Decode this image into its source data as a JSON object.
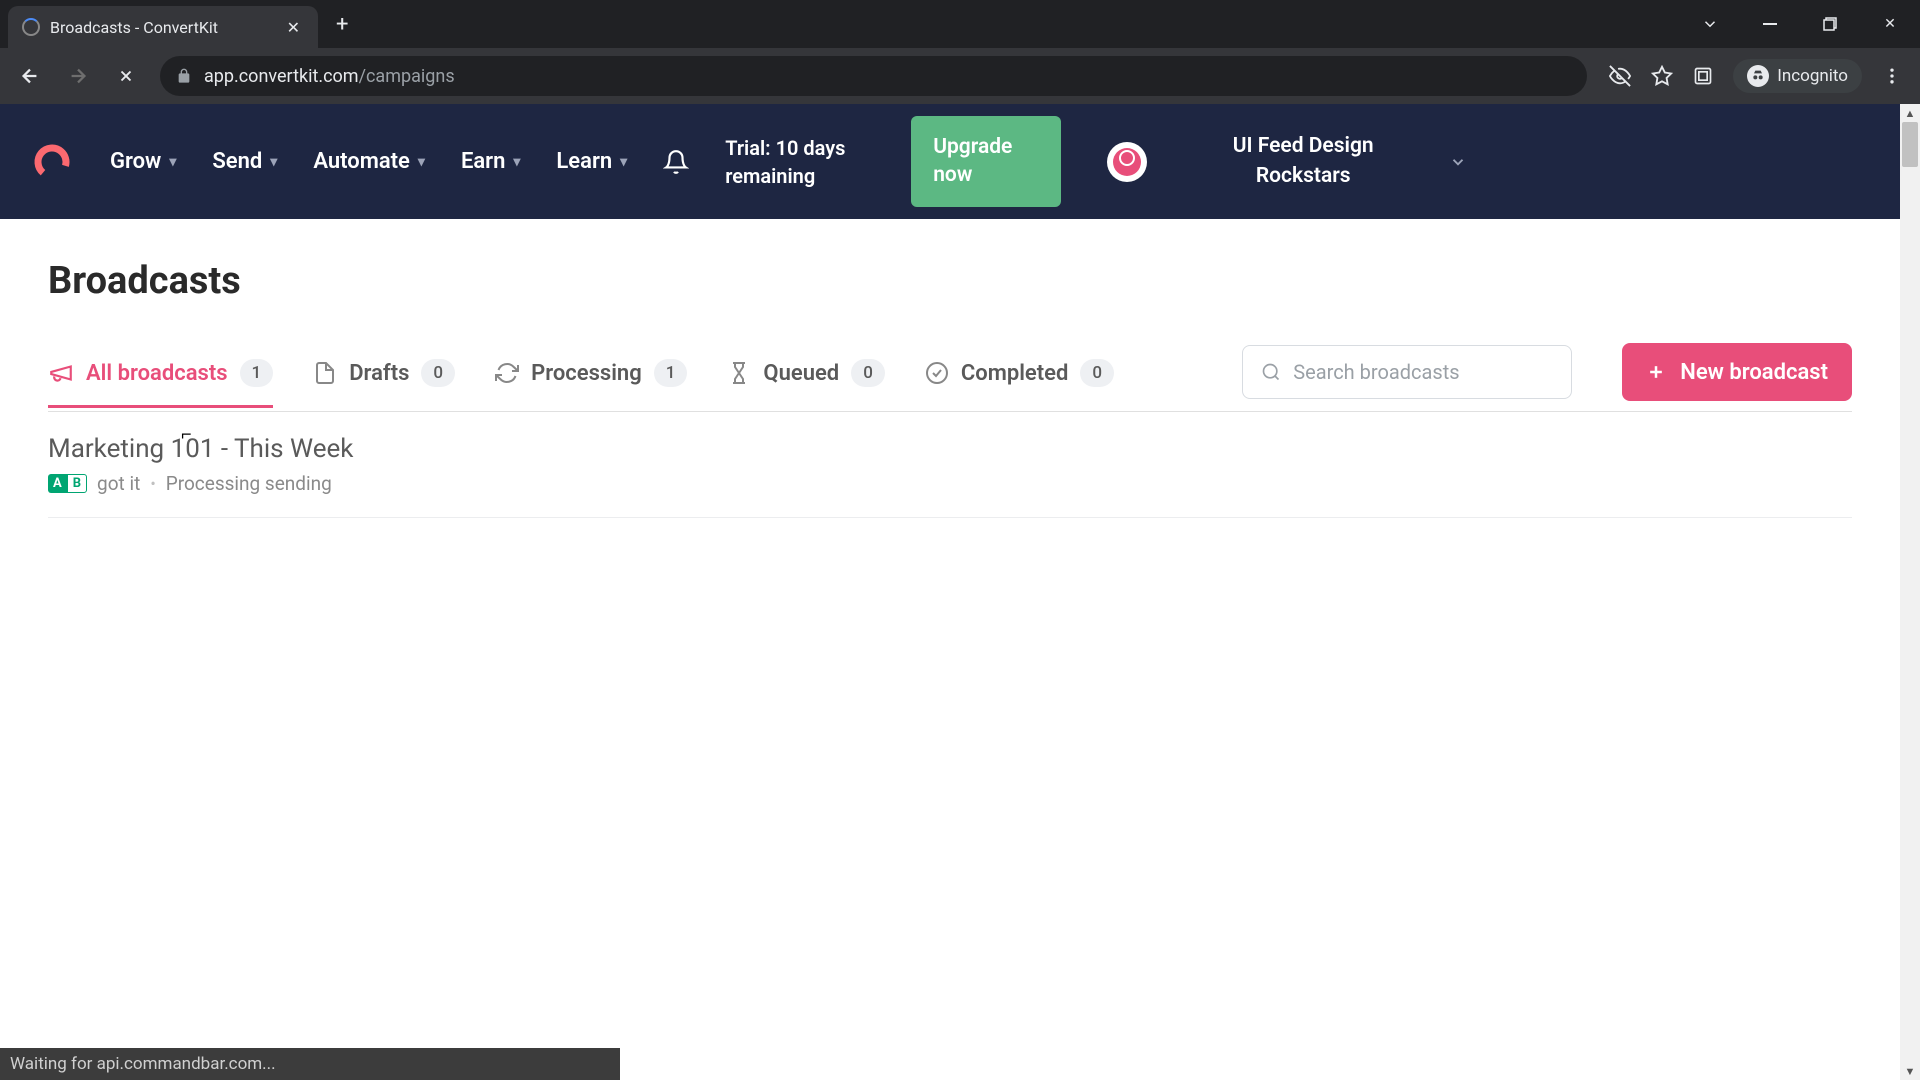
{
  "browser": {
    "tab_title": "Broadcasts - ConvertKit",
    "url_host": "app.convertkit.com",
    "url_path": "/campaigns",
    "incognito_label": "Incognito",
    "status_text": "Waiting for api.commandbar.com..."
  },
  "nav": {
    "items": [
      "Grow",
      "Send",
      "Automate",
      "Earn",
      "Learn"
    ],
    "trial_text": "Trial: 10 days remaining",
    "upgrade_label": "Upgrade now",
    "account_name": "UI Feed Design Rockstars"
  },
  "page": {
    "title": "Broadcasts",
    "search_placeholder": "Search broadcasts",
    "new_button_label": "New broadcast"
  },
  "tabs": [
    {
      "label": "All broadcasts",
      "count": "1",
      "active": true
    },
    {
      "label": "Drafts",
      "count": "0",
      "active": false
    },
    {
      "label": "Processing",
      "count": "1",
      "active": false
    },
    {
      "label": "Queued",
      "count": "0",
      "active": false
    },
    {
      "label": "Completed",
      "count": "0",
      "active": false
    }
  ],
  "broadcasts": [
    {
      "title": "Marketing 101 - This Week",
      "subject": "got it",
      "status": "Processing sending",
      "ab_test": true
    }
  ]
}
